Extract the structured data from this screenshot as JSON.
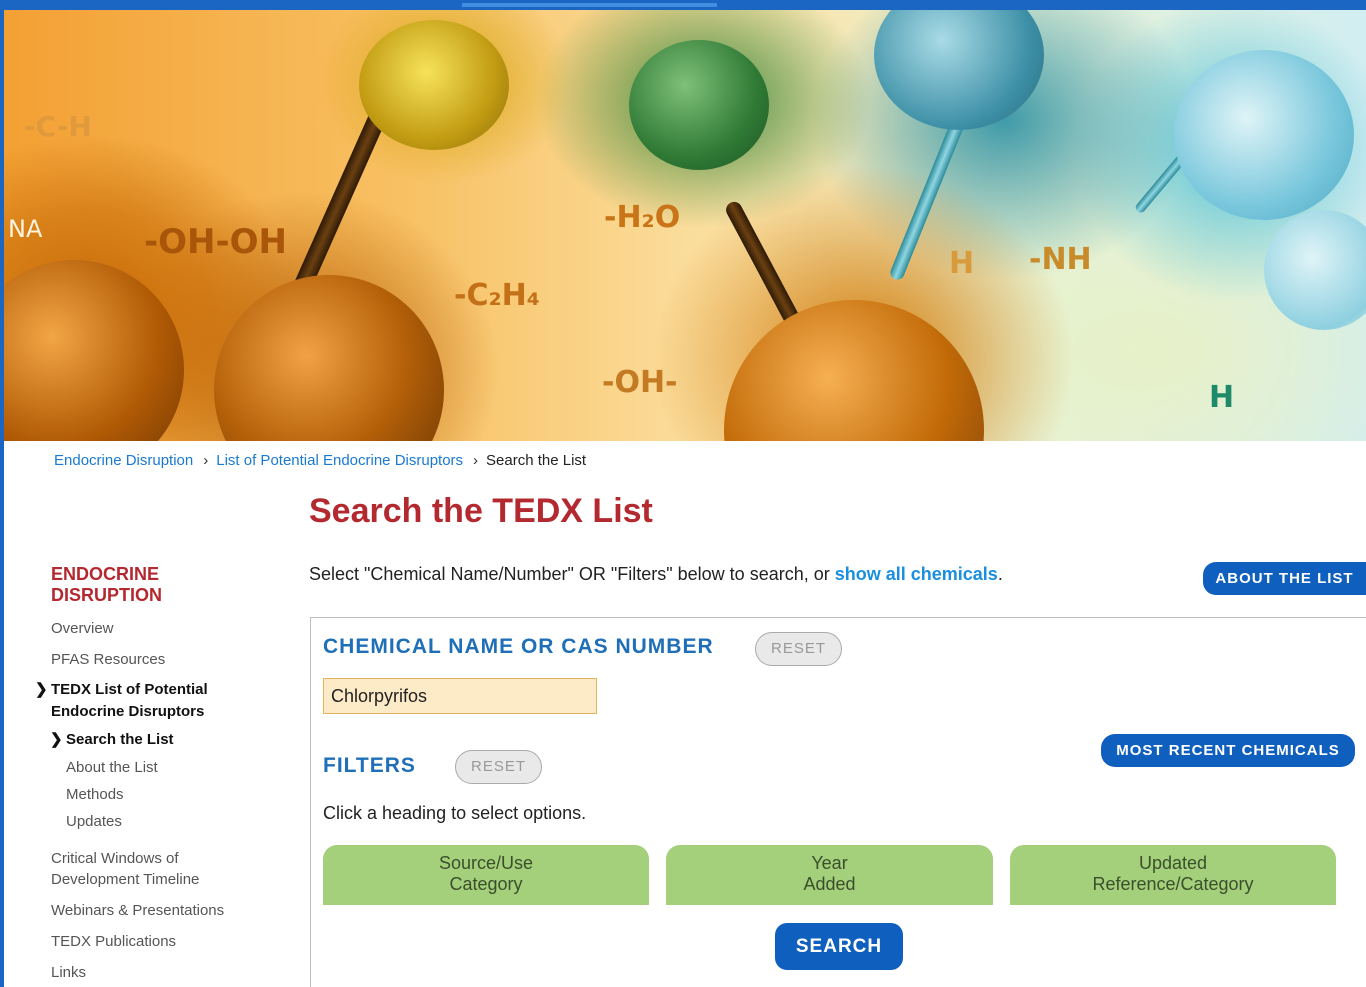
{
  "hero": {
    "formulas": [
      "-OH-OH",
      "-H₂O",
      "-C₂H₄",
      "-OH-",
      "H",
      "-NH",
      "NA",
      "H",
      "-C-H"
    ]
  },
  "breadcrumb": {
    "items": [
      "Endocrine Disruption",
      "List of Potential Endocrine Disruptors"
    ],
    "current": "Search the List",
    "separator": "›"
  },
  "page": {
    "title": "Search the TEDX List",
    "intro_text": "Select \"Chemical Name/Number\" OR \"Filters\" below to search, or ",
    "intro_link": "show all chemicals",
    "intro_end": "."
  },
  "sidebar": {
    "heading": "ENDOCRINE DISRUPTION",
    "items": [
      {
        "label": "Overview"
      },
      {
        "label": "PFAS Resources"
      },
      {
        "label": "TEDX List of Potential Endocrine Disruptors"
      },
      {
        "label": "Search the List"
      },
      {
        "label": "About the List"
      },
      {
        "label": "Methods"
      },
      {
        "label": "Updates"
      },
      {
        "label": "Critical Windows of Development Timeline"
      },
      {
        "label": "Webinars & Presentations"
      },
      {
        "label": "TEDX Publications"
      },
      {
        "label": "Links"
      }
    ]
  },
  "buttons": {
    "about_list": "ABOUT THE LIST",
    "most_recent": "MOST RECENT CHEMICALS",
    "reset": "RESET",
    "search": "SEARCH"
  },
  "chemical_section": {
    "heading": "CHEMICAL NAME OR CAS NUMBER",
    "input_value": "Chlorpyrifos"
  },
  "filters_section": {
    "heading": "FILTERS",
    "hint": "Click a heading to select options.",
    "tabs": [
      "Source/Use\nCategory",
      "Year\nAdded",
      "Updated\nReference/Category"
    ]
  },
  "colors": {
    "brand_blue": "#0f5fbe",
    "title_red": "#b3292f",
    "link_blue": "#1a7ad1",
    "filter_green": "#a4cf7b"
  }
}
